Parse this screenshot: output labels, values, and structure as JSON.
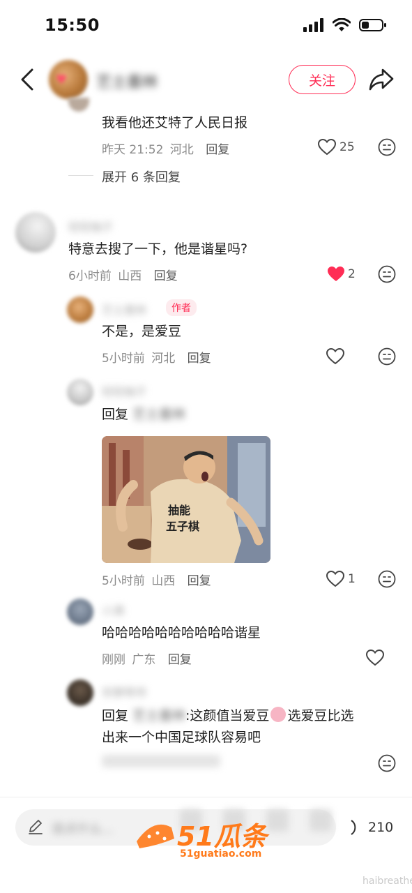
{
  "status_bar": {
    "time": "15:50"
  },
  "header": {
    "follow_label": "关注",
    "author_name": "艺士墨林"
  },
  "comments": [
    {
      "text": "我看他还艾特了人民日报",
      "time": "昨天 21:52",
      "location": "河北",
      "reply_label": "回复",
      "likes": "25"
    },
    {
      "expand_label": "展开 6 条回复"
    },
    {
      "username": "轻轻柚子",
      "text": "特意去搜了一下，他是谐星吗?",
      "time": "6小时前",
      "location": "山西",
      "reply_label": "回复",
      "likes": "2"
    },
    {
      "username": "艺士墨林",
      "author_tag": "作者",
      "text": "不是，是爱豆",
      "time": "5小时前",
      "location": "河北",
      "reply_label": "回复"
    },
    {
      "username": "轻轻柚子",
      "text_prefix": "回复",
      "reply_target": "艺士墨林",
      "gif_shirt_text": "抽能 五子棋",
      "time": "5小时前",
      "location": "山西",
      "reply_label": "回复",
      "likes": "1"
    },
    {
      "username": "小满",
      "text": "哈哈哈哈哈哈哈哈哈哈谐星",
      "time": "刚刚",
      "location": "广东",
      "reply_label": "回复"
    },
    {
      "username": "安静等待",
      "text_prefix": "回复",
      "reply_target": "艺士墨林",
      "text_line1": ":这颜值当爱豆",
      "text_line1_end": "选爱豆比选",
      "text_line2": "出来一个中国足球队容易吧"
    }
  ],
  "bottom_bar": {
    "comment_count": "210",
    "input_placeholder": "说点什么..."
  },
  "watermark": {
    "brand": "51瓜条",
    "url": "51guatiao.com",
    "corner": "haibreathe"
  },
  "colors": {
    "accent": "#ff2d55",
    "like_red": "#ff2d55",
    "meta_gray": "#8a8a8a"
  }
}
